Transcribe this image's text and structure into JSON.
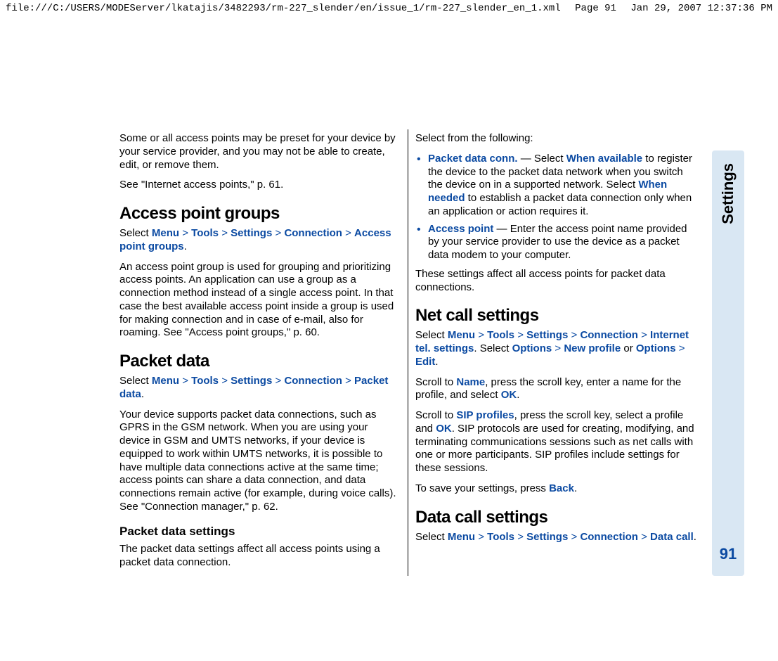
{
  "header": {
    "path": "file:///C:/USERS/MODEServer/lkatajis/3482293/rm-227_slender/en/issue_1/rm-227_slender_en_1.xml",
    "page_label": "Page 91",
    "timestamp": "Jan 29, 2007 12:37:36 PM"
  },
  "side": {
    "section": "Settings",
    "page_number": "91"
  },
  "left": {
    "intro_p1": "Some or all access points may be preset for your device by your service provider, and you may not be able to create, edit, or remove them.",
    "intro_p2": "See \"Internet access points,\" p. 61.",
    "h_apg": "Access point groups",
    "apg_select_prefix": "Select ",
    "menu": "Menu",
    "tools": "Tools",
    "settings": "Settings",
    "connection": "Connection",
    "apg_last": "Access point groups",
    "apg_body": "An access point group is used for grouping and prioritizing access points. An application can use a group as a connection method instead of a single access point. In that case the best available access point inside a group is used for making connection and in case of e-mail, also for roaming. See \"Access point groups,\" p. 60.",
    "h_pd": "Packet data",
    "pd_last": "Packet data",
    "pd_body": "Your device supports packet data connections, such as GPRS in the GSM network. When you are using your device in GSM and UMTS networks, if your device is equipped to work within UMTS networks, it is possible to have multiple data connections active at the same time; access points can share a data connection, and data connections remain active (for example, during voice calls). See \"Connection manager,\" p. 62.",
    "h_pds": "Packet data settings",
    "pds_body": "The packet data settings affect all access points using a packet data connection."
  },
  "right": {
    "select_from": "Select from the following:",
    "li1_term": "Packet data conn.",
    "li1_a": " — Select ",
    "li1_when_available": "When available",
    "li1_b": " to register the device to the packet data network when you switch the device on in a supported network. Select ",
    "li1_when_needed": "When needed",
    "li1_c": " to establish a packet data connection only when an application or action requires it.",
    "li2_term": "Access point",
    "li2_body": " — Enter the access point name provided by your service provider to use the device as a packet data modem to your computer.",
    "after_list": "These settings affect all access points for packet data connections.",
    "h_net": "Net call settings",
    "net_last": "Internet tel. settings",
    "net_sel": ". Select ",
    "options": "Options",
    "new_profile": "New profile",
    "or": " or ",
    "edit": "Edit",
    "net_p2a": "Scroll to ",
    "name_lbl": "Name",
    "net_p2b": ", press the scroll key, enter a name for the profile, and select ",
    "ok": "OK",
    "net_p3a": "Scroll to ",
    "sip_profiles": "SIP profiles",
    "net_p3b": ", press the scroll key, select a profile and ",
    "net_p3c": ". SIP protocols are used for creating, modifying, and terminating communications sessions such as net calls with one or more participants. SIP profiles include settings for these sessions.",
    "net_p4a": "To save your settings, press ",
    "back": "Back",
    "h_data": "Data call settings",
    "data_last": "Data call"
  },
  "chev": ">"
}
